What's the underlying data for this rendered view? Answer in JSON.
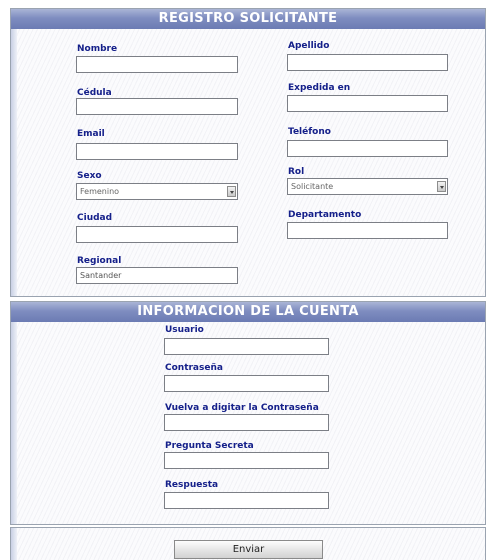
{
  "registro": {
    "title": "REGISTRO SOLICITANTE",
    "labels": {
      "nombre": "Nombre",
      "apellido": "Apellido",
      "cedula": "Cédula",
      "expedida": "Expedida en",
      "email": "Email",
      "telefono": "Teléfono",
      "sexo": "Sexo",
      "rol": "Rol",
      "ciudad": "Ciudad",
      "departamento": "Departamento",
      "regional": "Regional"
    },
    "values": {
      "nombre": "",
      "apellido": "",
      "cedula": "",
      "expedida": "",
      "email": "",
      "telefono": "",
      "ciudad": "",
      "departamento": "",
      "regional": "Santander"
    },
    "selects": {
      "sexo": "Femenino",
      "rol": "Solicitante"
    }
  },
  "cuenta": {
    "title": "INFORMACION DE LA CUENTA",
    "labels": {
      "usuario": "Usuario",
      "contrasena": "Contraseña",
      "confirmar": "Vuelva a digitar la Contraseña",
      "pregunta": "Pregunta Secreta",
      "respuesta": "Respuesta"
    },
    "values": {
      "usuario": "",
      "contrasena": "",
      "confirmar": "",
      "pregunta": "",
      "respuesta": ""
    }
  },
  "actions": {
    "submit_label": "Enviar"
  }
}
